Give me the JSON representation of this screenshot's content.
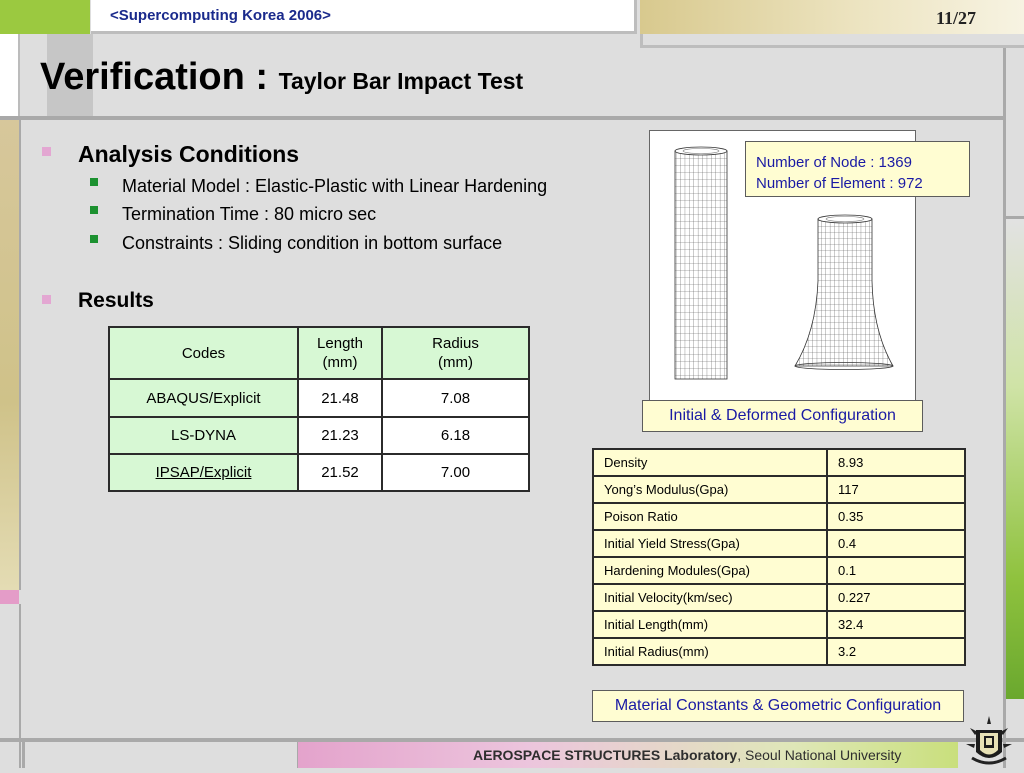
{
  "header": {
    "conference": "<Supercomputing Korea 2006>",
    "page_number": "11/27"
  },
  "title": {
    "main": "Verification : ",
    "sub": "Taylor Bar Impact Test"
  },
  "sections": [
    {
      "heading": "Analysis Conditions",
      "items": [
        "Material Model : Elastic-Plastic with Linear Hardening",
        "Termination Time : 80 micro sec",
        "Constraints : Sliding condition in bottom surface"
      ]
    },
    {
      "heading": "Results",
      "items": []
    }
  ],
  "results_table": {
    "headers": [
      "Codes",
      "Length",
      "(mm)",
      "Radius",
      "(mm)"
    ],
    "rows": [
      [
        "ABAQUS/Explicit",
        "21.48",
        "7.08"
      ],
      [
        "LS-DYNA",
        "21.23",
        "6.18"
      ],
      [
        "IPSAP/Explicit",
        "21.52",
        "7.00"
      ]
    ]
  },
  "figure": {
    "mesh_info": [
      "Number of Node : 1369",
      "Number of Element : 972"
    ],
    "caption": "Initial & Deformed Configuration"
  },
  "material_table": {
    "rows": [
      [
        "Density",
        "8.93"
      ],
      [
        "Yong’s Modulus(Gpa)",
        "117"
      ],
      [
        "Poison Ratio",
        "0.35"
      ],
      [
        "Initial Yield Stress(Gpa)",
        "0.4"
      ],
      [
        "Hardening Modules(Gpa)",
        "0.1"
      ],
      [
        "Initial Velocity(km/sec)",
        "0.227"
      ],
      [
        "Initial Length(mm)",
        "32.4"
      ],
      [
        "Initial Radius(mm)",
        "3.2"
      ]
    ],
    "caption": "Material Constants & Geometric Configuration"
  },
  "footer": {
    "lab": "AEROSPACE STRUCTURES Laboratory",
    "university": ", Seoul National University",
    "logo_text": "VERITAS LUX MEA",
    "logo_icon": "university-seal-icon"
  },
  "colors": {
    "accent_blue": "#1a1aa4",
    "table_green": "#d7f8d4",
    "note_yellow": "#fffdd2",
    "bullet_pink": "#e3a7d2",
    "bullet_green": "#1c9130"
  }
}
